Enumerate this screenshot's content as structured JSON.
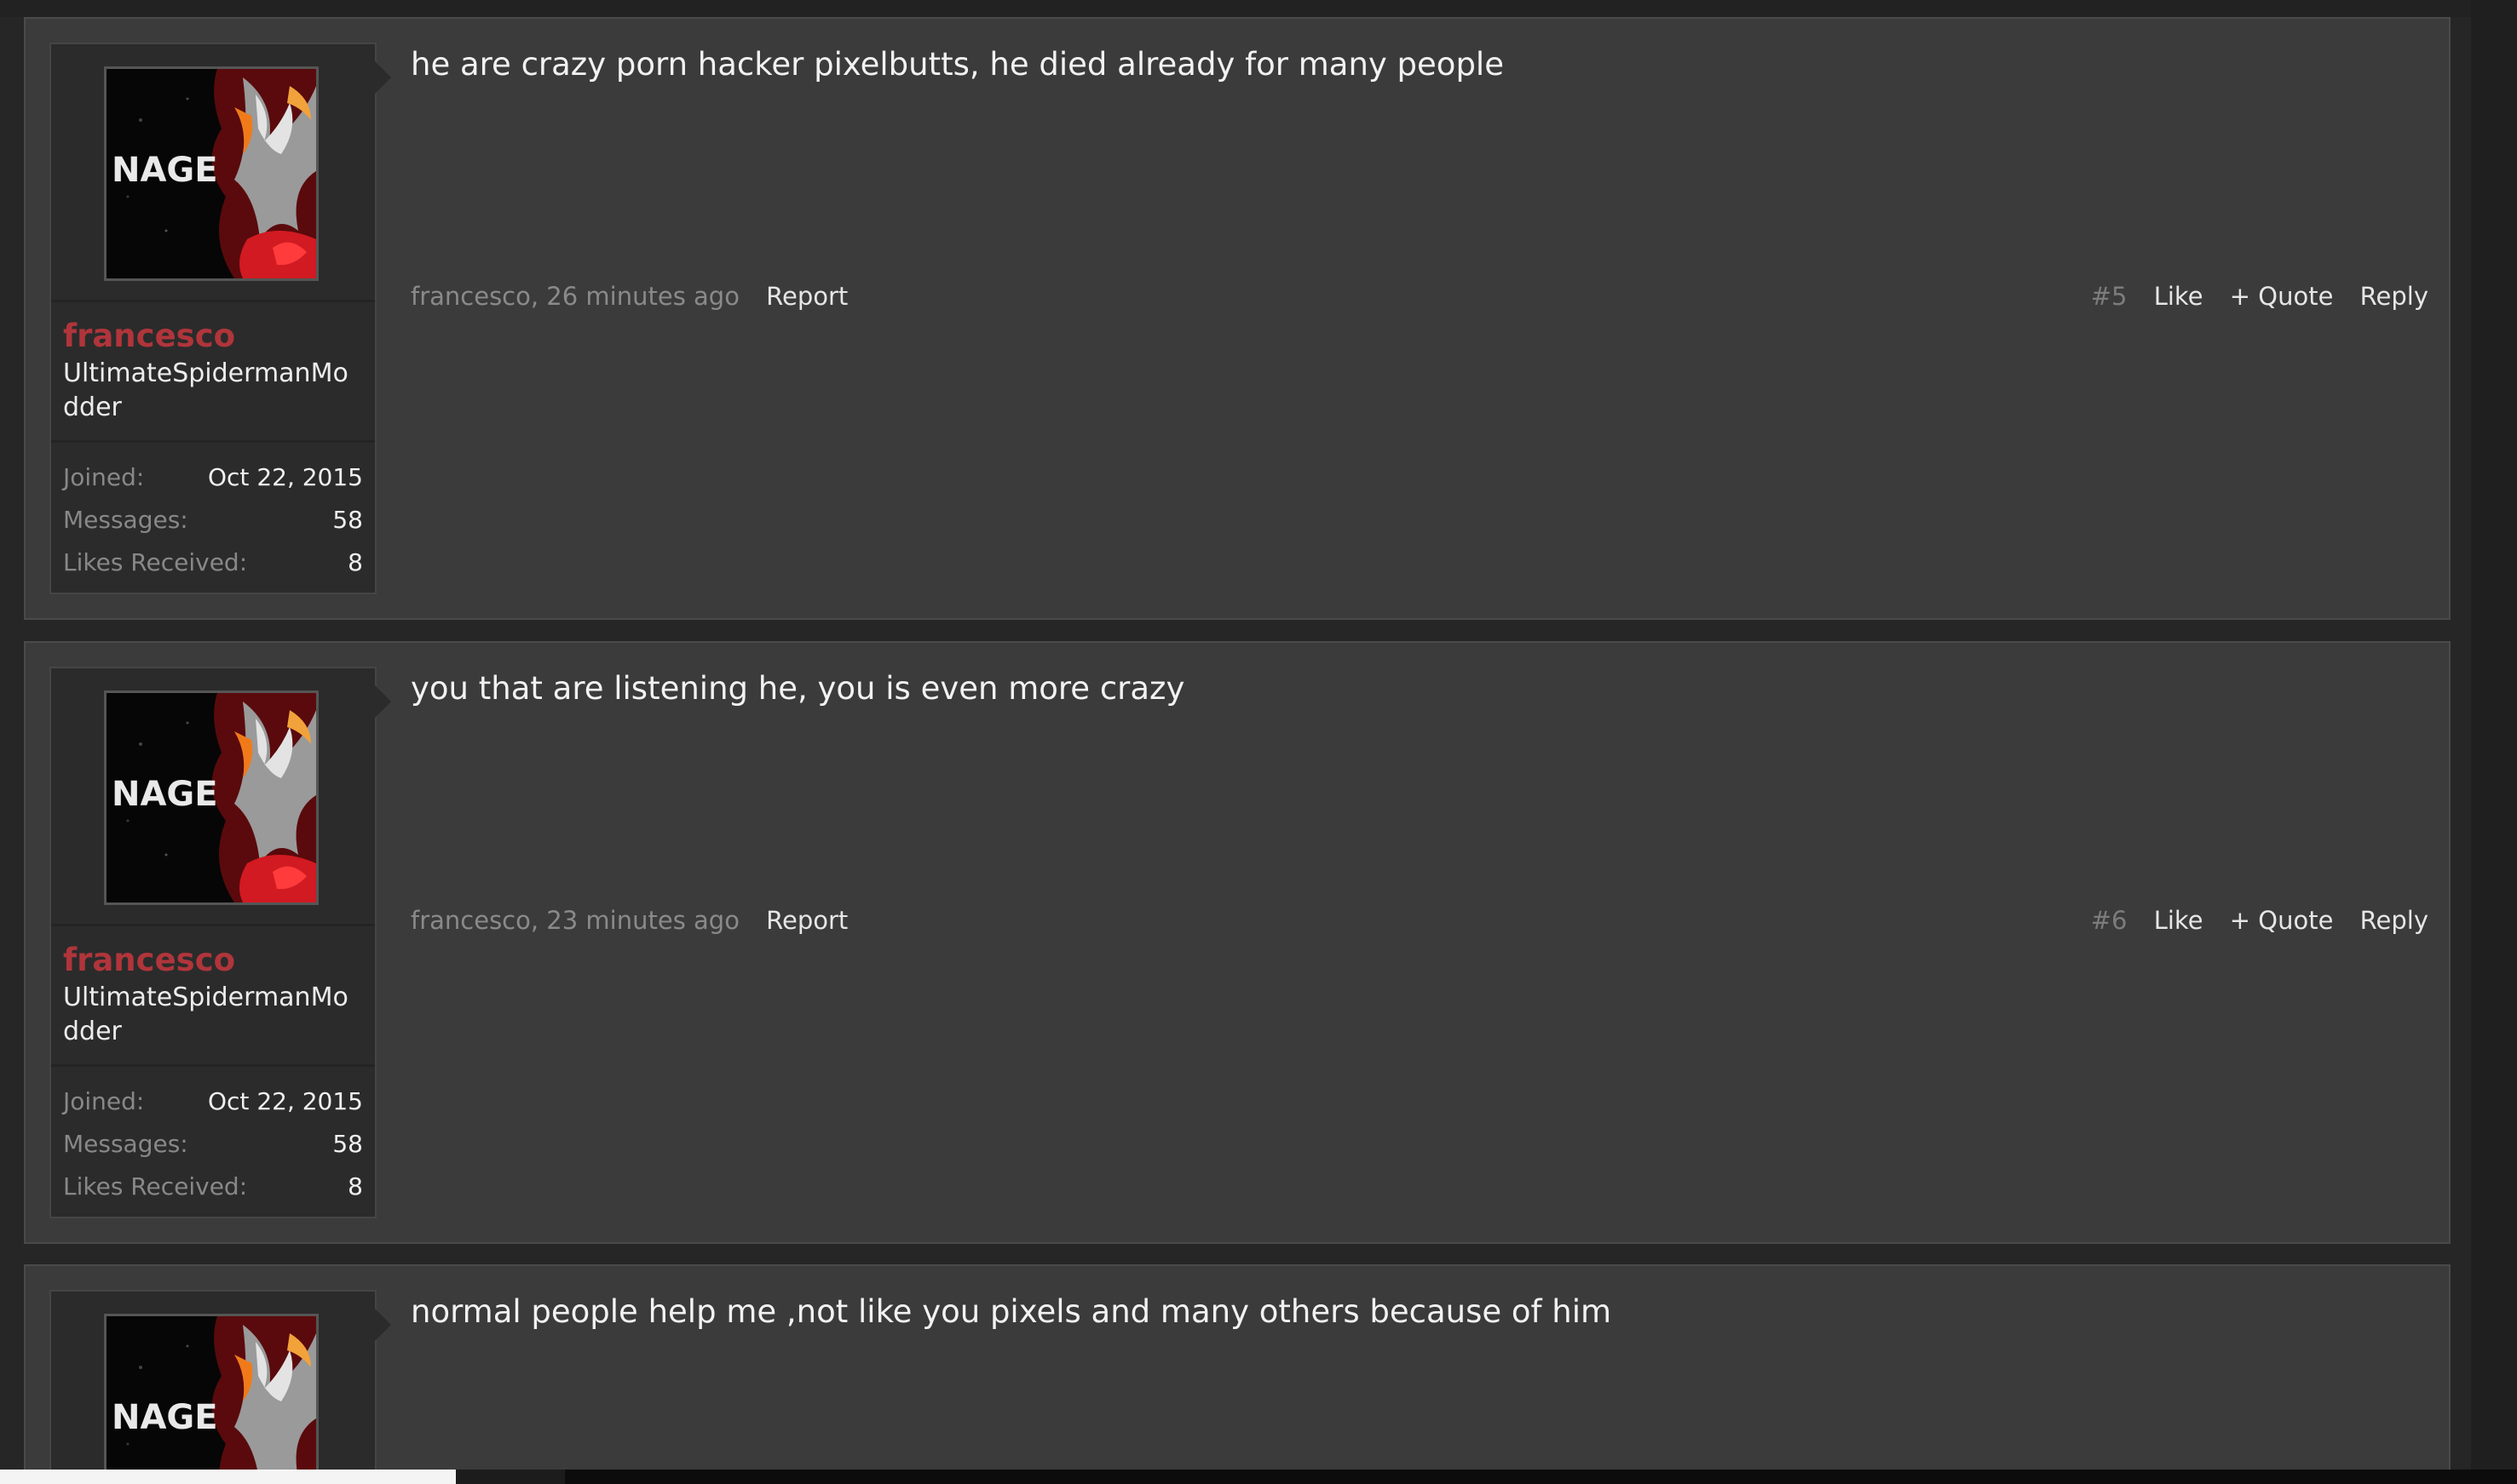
{
  "posts": [
    {
      "user": {
        "name": "francesco",
        "title": "UltimateSpidermanModder",
        "avatar_text": "NAGE",
        "stats": [
          {
            "label": "Joined:",
            "value": "Oct 22, 2015"
          },
          {
            "label": "Messages:",
            "value": "58"
          },
          {
            "label": "Likes Received:",
            "value": "8"
          }
        ]
      },
      "message": "he are crazy porn hacker pixelbutts, he died already for many people",
      "meta": {
        "author_time": "francesco, 26 minutes ago",
        "report_label": "Report"
      },
      "controls": {
        "number": "#5",
        "like": "Like",
        "quote": "+ Quote",
        "reply": "Reply"
      }
    },
    {
      "user": {
        "name": "francesco",
        "title": "UltimateSpidermanModder",
        "avatar_text": "NAGE",
        "stats": [
          {
            "label": "Joined:",
            "value": "Oct 22, 2015"
          },
          {
            "label": "Messages:",
            "value": "58"
          },
          {
            "label": "Likes Received:",
            "value": "8"
          }
        ]
      },
      "message": "you that are listening he, you is even more crazy",
      "meta": {
        "author_time": "francesco, 23 minutes ago",
        "report_label": "Report"
      },
      "controls": {
        "number": "#6",
        "like": "Like",
        "quote": "+ Quote",
        "reply": "Reply"
      }
    },
    {
      "user": {
        "avatar_text": "NAGE"
      },
      "message": "normal people help me ,not like you pixels and many others because of him"
    }
  ],
  "colors": {
    "username": "#b0353b",
    "post_background": "#3b3b3b",
    "page_background": "#262626"
  }
}
